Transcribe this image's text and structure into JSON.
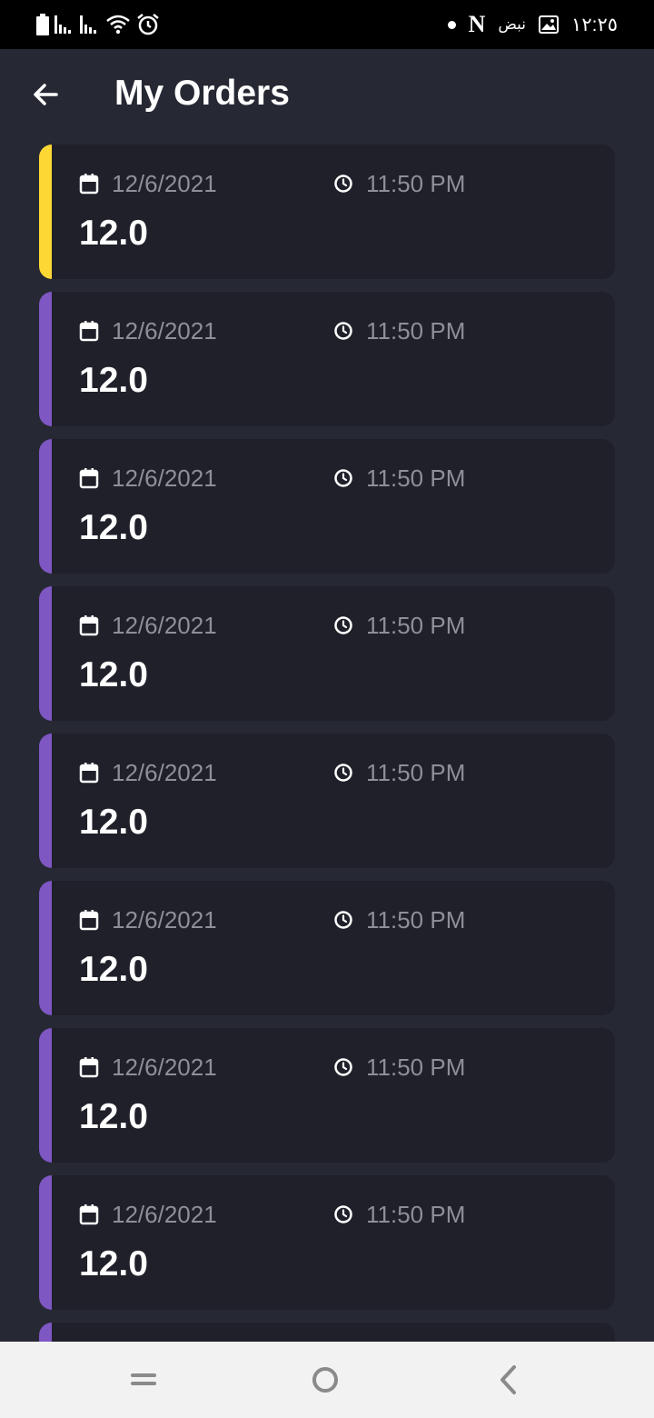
{
  "status_bar": {
    "time": "١٢:٢٥",
    "notification_text": "نبض",
    "netflix_letter": "N"
  },
  "header": {
    "title": "My Orders"
  },
  "colors": {
    "background": "#262833",
    "card": "#1f2029",
    "accent_active": "#fdd835",
    "accent_default": "#7e57c2",
    "muted_text": "#8e8f97"
  },
  "orders": [
    {
      "date": "12/6/2021",
      "time": "11:50 PM",
      "amount": "12.0",
      "accent": "yellow"
    },
    {
      "date": "12/6/2021",
      "time": "11:50 PM",
      "amount": "12.0",
      "accent": "purple"
    },
    {
      "date": "12/6/2021",
      "time": "11:50 PM",
      "amount": "12.0",
      "accent": "purple"
    },
    {
      "date": "12/6/2021",
      "time": "11:50 PM",
      "amount": "12.0",
      "accent": "purple"
    },
    {
      "date": "12/6/2021",
      "time": "11:50 PM",
      "amount": "12.0",
      "accent": "purple"
    },
    {
      "date": "12/6/2021",
      "time": "11:50 PM",
      "amount": "12.0",
      "accent": "purple"
    },
    {
      "date": "12/6/2021",
      "time": "11:50 PM",
      "amount": "12.0",
      "accent": "purple"
    },
    {
      "date": "12/6/2021",
      "time": "11:50 PM",
      "amount": "12.0",
      "accent": "purple"
    },
    {
      "date": "",
      "time": "",
      "amount": "",
      "accent": "purple"
    }
  ],
  "icons": {
    "back": "arrow-left-icon",
    "date": "calendar-icon",
    "time": "clock-icon",
    "nav_recents": "recents-icon",
    "nav_home": "home-icon",
    "nav_back": "back-chevron-icon"
  }
}
